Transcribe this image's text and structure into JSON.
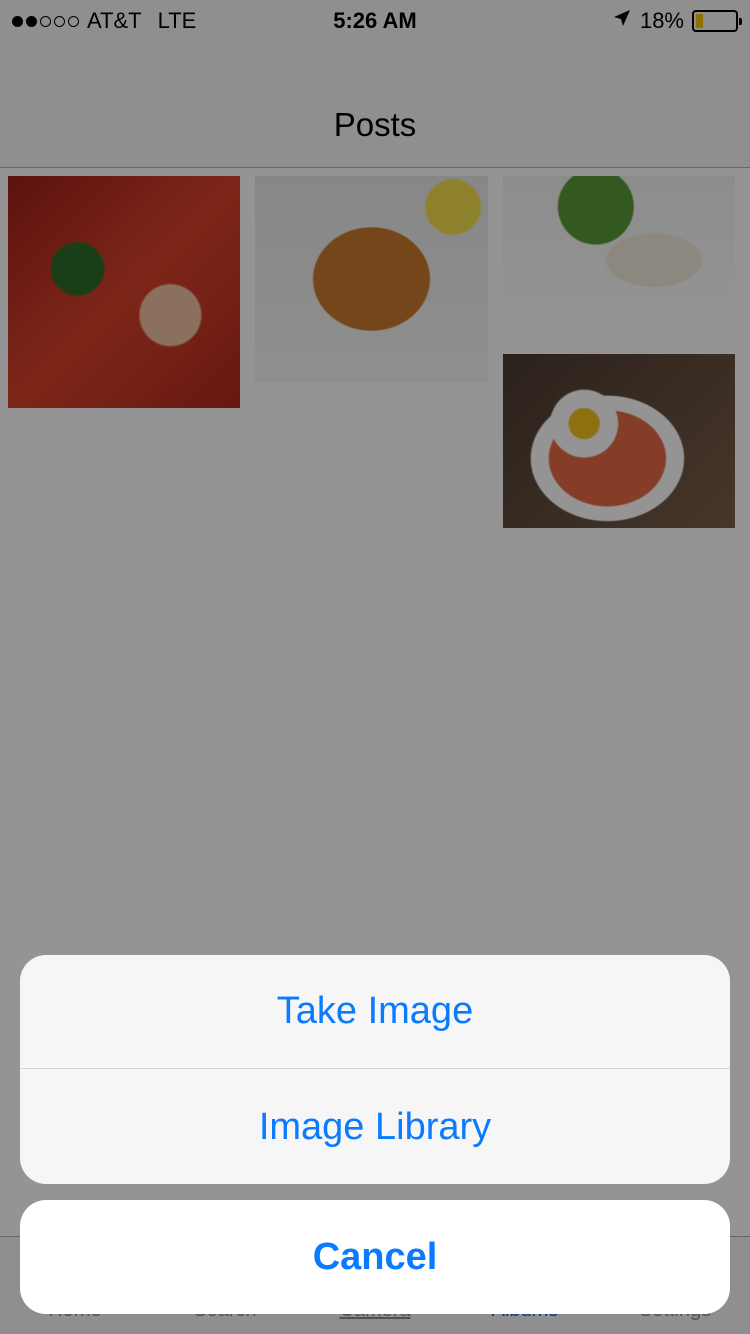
{
  "status_bar": {
    "carrier": "AT&T",
    "network": "LTE",
    "signal_strength": 2,
    "signal_total": 5,
    "time": "5:26 AM",
    "battery_percent": "18%",
    "battery_level": 0.18,
    "location_icon": "location-arrow-icon"
  },
  "nav": {
    "title": "Posts"
  },
  "posts": [
    {
      "name": "photo-seafood-soup"
    },
    {
      "name": "photo-fried-calamari"
    },
    {
      "name": "photo-seared-scallop"
    },
    {
      "name": "photo-fried-rice-egg"
    }
  ],
  "tabs": [
    {
      "label": "Home"
    },
    {
      "label": "Search"
    },
    {
      "label": "Camera"
    },
    {
      "label": "Albums",
      "active": true
    },
    {
      "label": "Settings"
    }
  ],
  "action_sheet": {
    "options": [
      {
        "label": "Take Image"
      },
      {
        "label": "Image Library"
      }
    ],
    "cancel_label": "Cancel"
  },
  "colors": {
    "accent": "#0a7bff",
    "overlay": "rgba(0,0,0,0.42)",
    "battery_fill": "#f5c400"
  }
}
